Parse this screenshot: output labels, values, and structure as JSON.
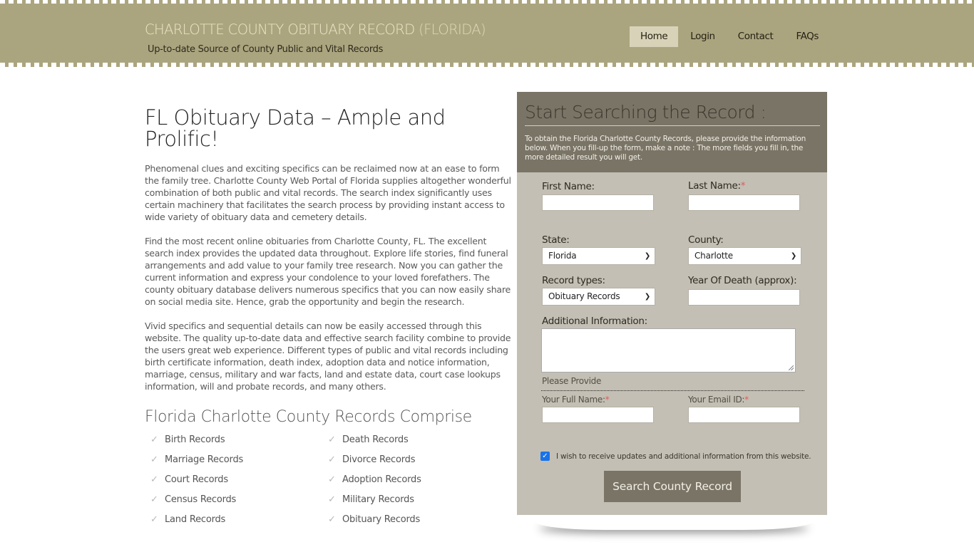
{
  "header": {
    "title_main": "CHARLOTTE COUNTY OBITUARY RECORD",
    "title_state": "(FLORIDA)",
    "tagline": "Up-to-date Source of  County Public and Vital Records",
    "colors": {
      "band": "#aba57f",
      "active_tab": "#d8d3b8"
    }
  },
  "nav": {
    "items": [
      {
        "label": "Home",
        "active": true
      },
      {
        "label": "Login",
        "active": false
      },
      {
        "label": "Contact",
        "active": false
      },
      {
        "label": "FAQs",
        "active": false
      }
    ]
  },
  "main": {
    "title": "FL Obituary Data – Ample and Prolific!",
    "paragraphs": [
      "Phenomenal clues and exciting specifics can be reclaimed now at an ease to form the family tree. Charlotte County Web Portal of Florida supplies altogether wonderful combination of both public and vital records. The search index significantly uses certain machinery that facilitates the search process by providing instant access to wide variety of obituary data and cemetery details.",
      "Find the most recent online obituaries from Charlotte County, FL. The excellent search index provides the updated data throughout. Explore life stories, find funeral arrangements and add value to your family tree research. Now you can gather the current information and express your condolence to your loved forefathers. The county obituary database delivers numerous specifics that you can now easily share on social media site. Hence, grab the opportunity and begin the research.",
      "Vivid specifics and sequential details can now be easily accessed through this website. The quality up-to-date data and effective search facility combine to provide the users great web experience. Different types of public and vital records including birth certificate information, death index, adoption data and notice information, marriage, census, military and war facts, land and estate data, court case lookups information, will and probate records, and many others."
    ],
    "records_heading": "Florida Charlotte County Records Comprise",
    "records": [
      "Birth Records",
      "Death Records",
      "Marriage Records",
      "Divorce Records",
      "Court Records",
      "Adoption Records",
      "Census Records",
      "Military Records",
      "Land Records",
      "Obituary Records"
    ],
    "check_icon": "✓"
  },
  "form": {
    "title": "Start Searching the Record :",
    "intro": "To obtain the Florida Charlotte County Records, please provide the information below. When you fill-up the form, make a note : The more fields you fill in, the more detailed result you will get.",
    "required_mark": "*",
    "first_name": {
      "label": "First Name:",
      "value": ""
    },
    "last_name": {
      "label": "Last Name:",
      "value": ""
    },
    "state": {
      "label": "State:",
      "value": "Florida"
    },
    "county": {
      "label": "County:",
      "value": "Charlotte"
    },
    "record_type": {
      "label": "Record types:",
      "value": "Obituary Records"
    },
    "year_of_death": {
      "label": "Year Of Death (approx):",
      "value": ""
    },
    "additional": {
      "label": "Additional Information:",
      "value": ""
    },
    "please_provide": "Please Provide",
    "full_name": {
      "label": "Your Full Name:",
      "value": ""
    },
    "email": {
      "label": "Your Email ID:",
      "value": ""
    },
    "optin": {
      "label": "I wish to receive updates and additional information from this website.",
      "checked": true
    },
    "submit_label": "Search County Record",
    "colors": {
      "head": "#7a7466",
      "body": "#c3bfb4",
      "required": "#e25a5a"
    }
  }
}
